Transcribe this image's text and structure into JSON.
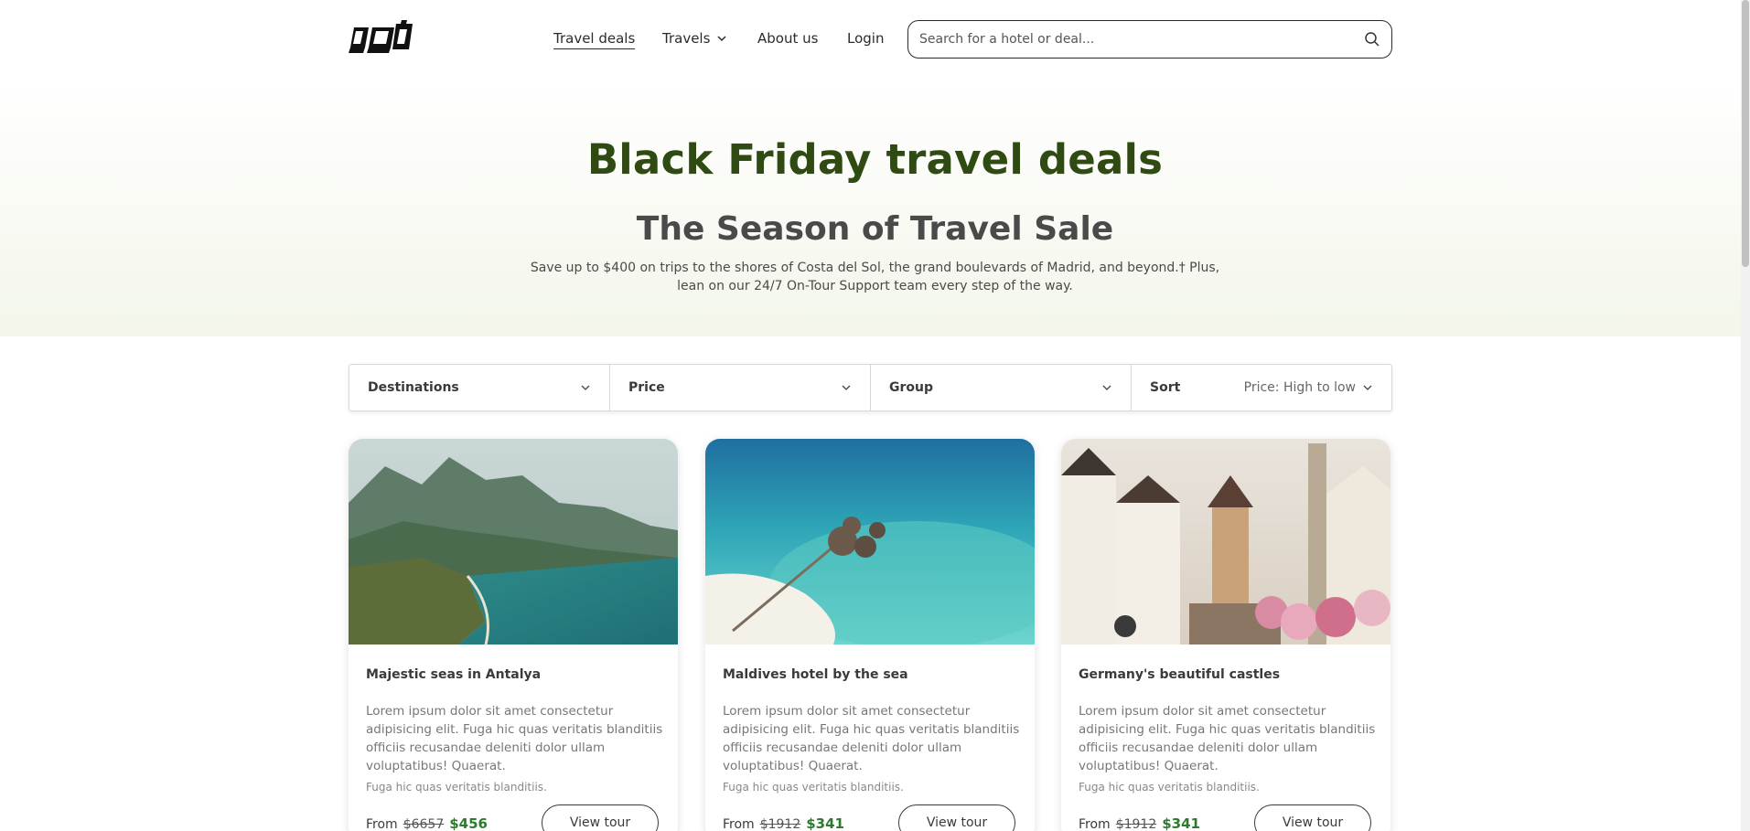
{
  "nav": {
    "items": [
      {
        "label": "Travel deals"
      },
      {
        "label": "Travels"
      },
      {
        "label": "About us"
      },
      {
        "label": "Login"
      }
    ]
  },
  "search": {
    "placeholder": "Search for a hotel or deal...",
    "value": ""
  },
  "hero": {
    "title": "Black Friday travel deals",
    "subtitle": "The Season of Travel Sale",
    "text": "Save up to $400 on trips to the shores of Costa del Sol, the grand boulevards of Madrid, and beyond.† Plus, lean on our 24/7 On-Tour Support team every step of the way."
  },
  "filters": {
    "destinations": "Destinations",
    "price": "Price",
    "group": "Group",
    "sort_label": "Sort",
    "sort_value": "Price: High to low"
  },
  "cards": [
    {
      "title": "Majestic seas in Antalya",
      "desc": "Lorem ipsum dolor sit amet consectetur adipisicing elit. Fuga hic quas veritatis blanditiis officiis recusandae deleniti dolor ullam voluptatibus! Quaerat.",
      "small": "Fuga hic quas veritatis blanditiis.",
      "from": "From",
      "old_price": "$6657",
      "new_price": "$456",
      "button": "View tour"
    },
    {
      "title": "Maldives hotel by the sea",
      "desc": "Lorem ipsum dolor sit amet consectetur adipisicing elit. Fuga hic quas veritatis blanditiis officiis recusandae deleniti dolor ullam voluptatibus! Quaerat.",
      "small": "Fuga hic quas veritatis blanditiis.",
      "from": "From",
      "old_price": "$1912",
      "new_price": "$341",
      "button": "View tour"
    },
    {
      "title": "Germany's beautiful castles",
      "desc": "Lorem ipsum dolor sit amet consectetur adipisicing elit. Fuga hic quas veritatis blanditiis officiis recusandae deleniti dolor ullam voluptatibus! Quaerat.",
      "small": "Fuga hic quas veritatis blanditiis.",
      "from": "From",
      "old_price": "$1912",
      "new_price": "$341",
      "button": "View tour"
    }
  ],
  "colors": {
    "hero_title": "#2f4a12",
    "price_new": "#2d7a2d",
    "hero_bg": "#f3f6ea"
  },
  "icons": [
    "logo-icon",
    "chevron-down-icon",
    "search-icon"
  ]
}
